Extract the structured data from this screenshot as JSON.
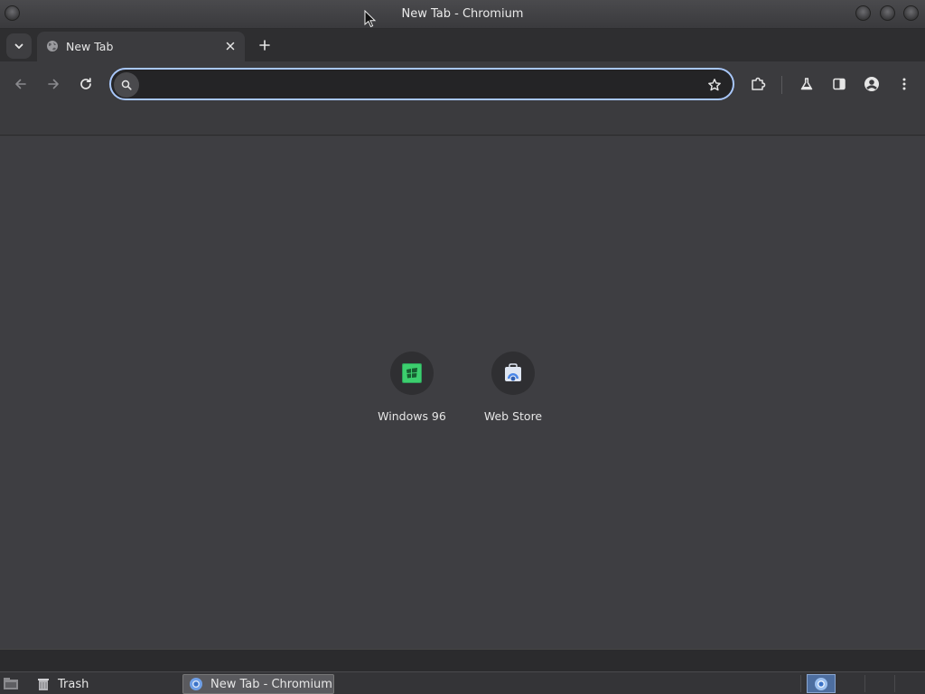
{
  "window": {
    "title": "New Tab - Chromium"
  },
  "tabs": [
    {
      "title": "New Tab",
      "icon": "globe-icon",
      "active": true
    }
  ],
  "omnibox": {
    "value": "",
    "placeholder": ""
  },
  "shortcuts": [
    {
      "label": "Windows 96",
      "icon": "windows96-icon",
      "color": "#3ccf6e"
    },
    {
      "label": "Web Store",
      "icon": "web-store-icon",
      "color": "#4a86e8"
    }
  ],
  "taskbar": {
    "items": [
      {
        "label": "Trash",
        "icon": "trash-icon"
      },
      {
        "label": "New Tab - Chromium",
        "icon": "chromium-icon",
        "active": true
      }
    ]
  },
  "colors": {
    "accent": "#a8c7fa",
    "content_bg": "#3e3e42",
    "toolbar_bg": "#3b3b3e"
  }
}
